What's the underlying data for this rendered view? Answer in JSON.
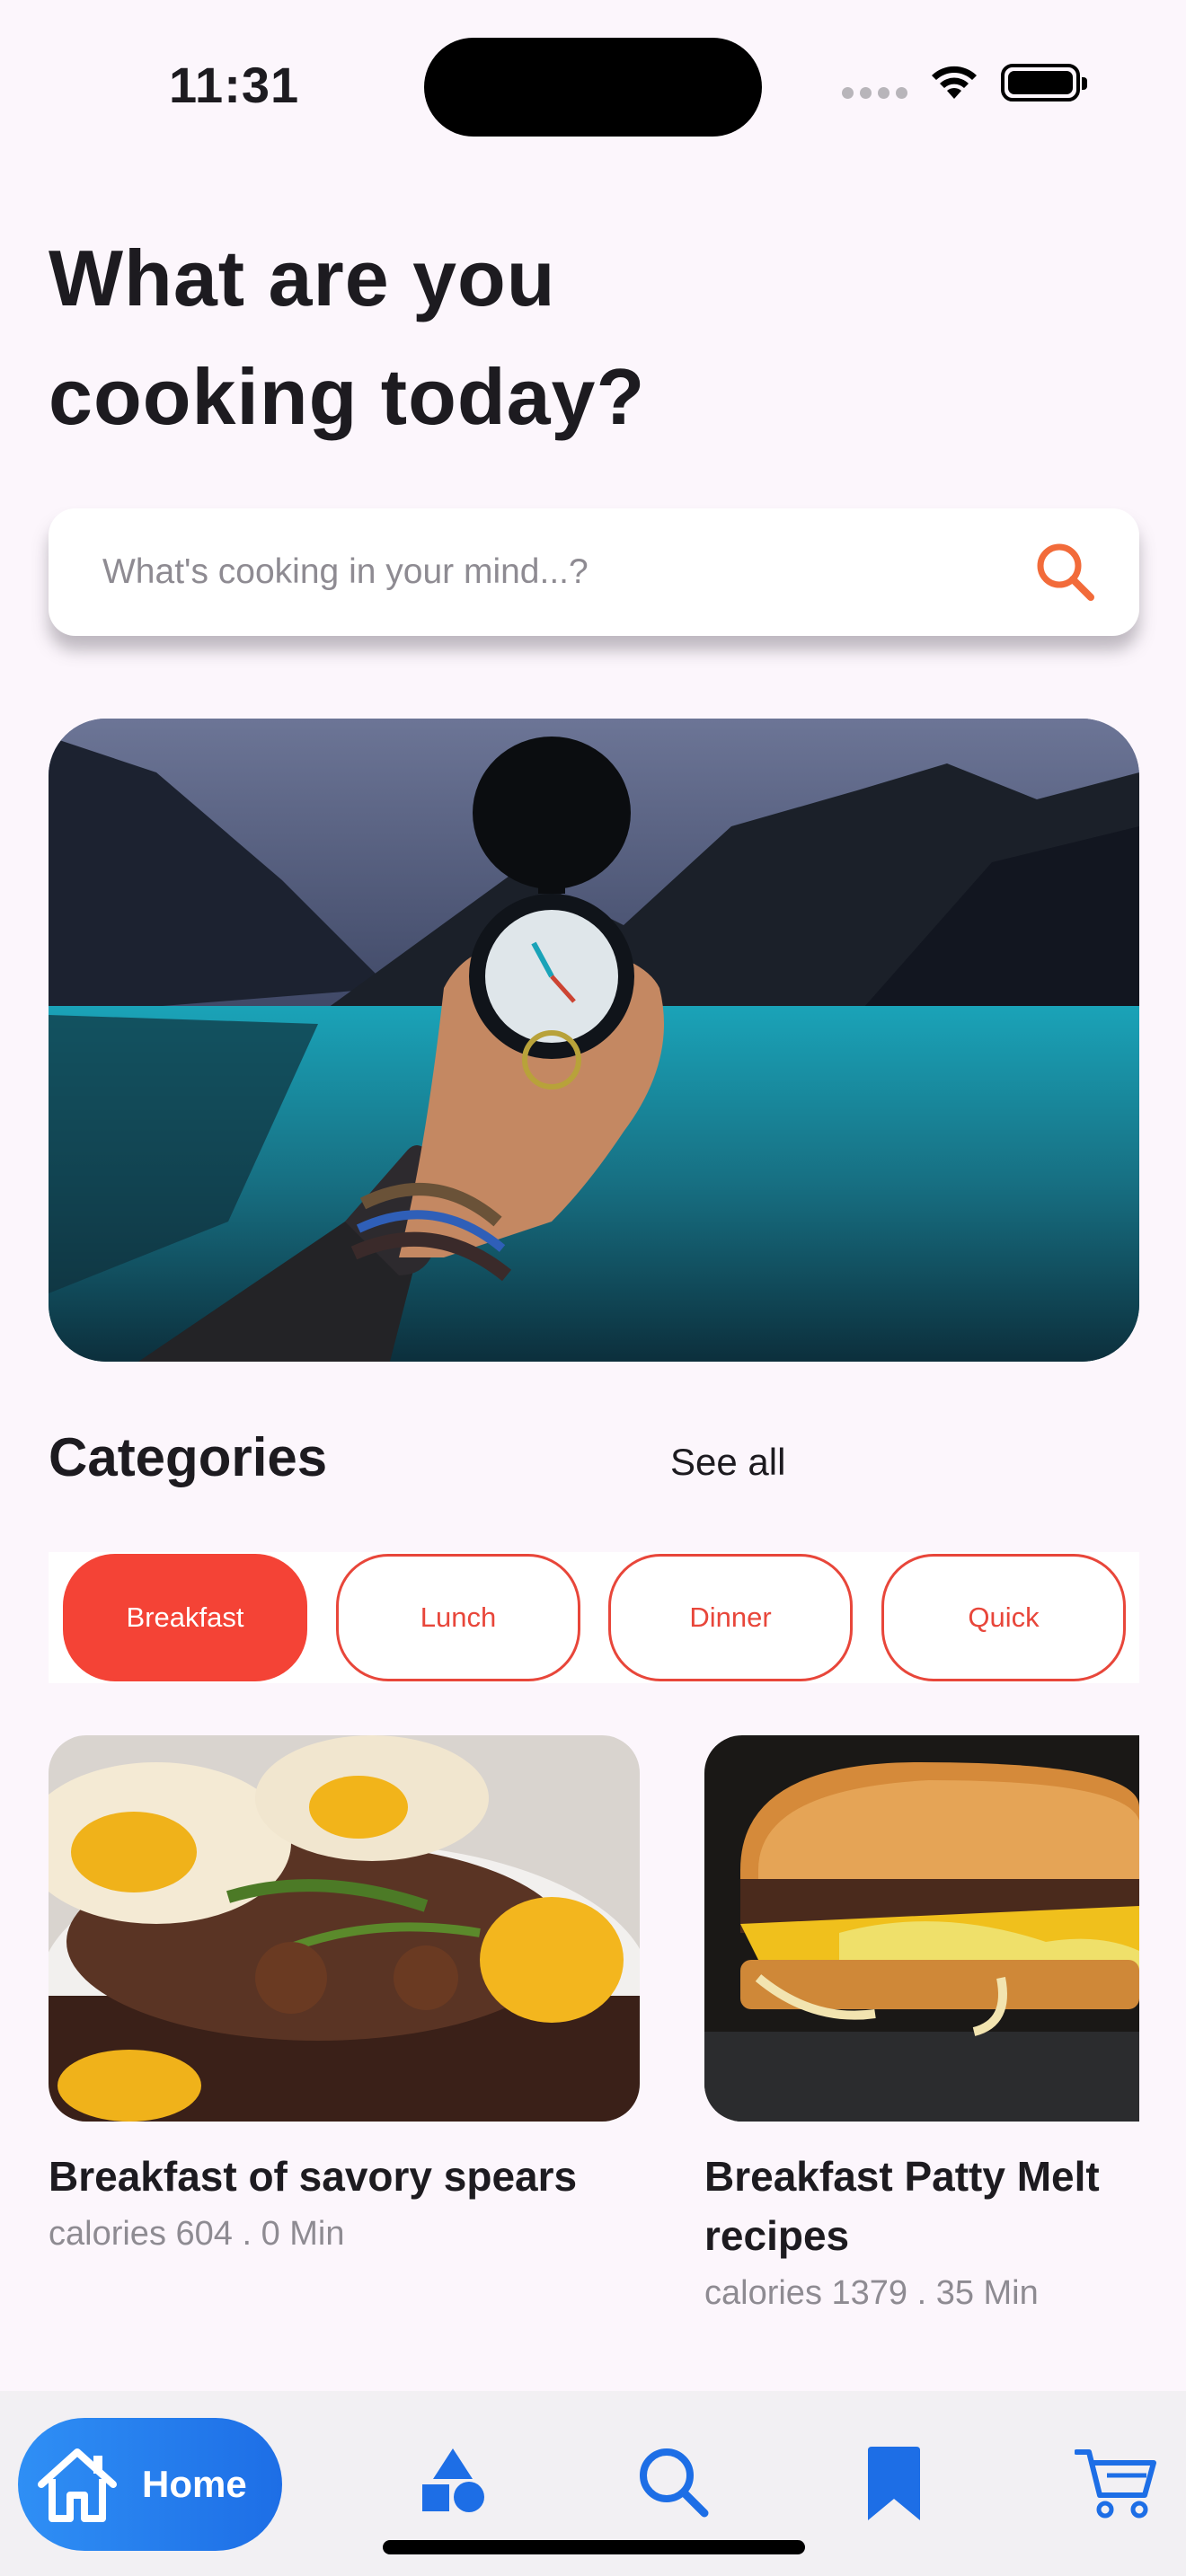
{
  "status_bar": {
    "time": "11:31"
  },
  "heading": "What are you cooking today?",
  "search": {
    "placeholder": "What's cooking in your mind...?",
    "value": ""
  },
  "categories": {
    "title": "Categories",
    "see_all": "See all",
    "chips": [
      {
        "label": "Breakfast",
        "selected": true
      },
      {
        "label": "Lunch",
        "selected": false
      },
      {
        "label": "Dinner",
        "selected": false
      },
      {
        "label": "Quick",
        "selected": false
      }
    ]
  },
  "recipes": [
    {
      "title": "Breakfast of savory spears",
      "meta": "calories 604 . 0 Min"
    },
    {
      "title": "Breakfast Patty Melt recipes",
      "meta": "calories 1379 . 35 Min"
    }
  ],
  "nav": {
    "home_label": "Home",
    "icons": [
      "home-icon",
      "categories-icon",
      "search-icon",
      "bookmark-icon",
      "cart-icon"
    ]
  },
  "colors": {
    "accent_red": "#f44336",
    "accent_orange": "#f26b3a",
    "nav_blue": "#1d6ee6",
    "background": "#fcf6fc"
  }
}
